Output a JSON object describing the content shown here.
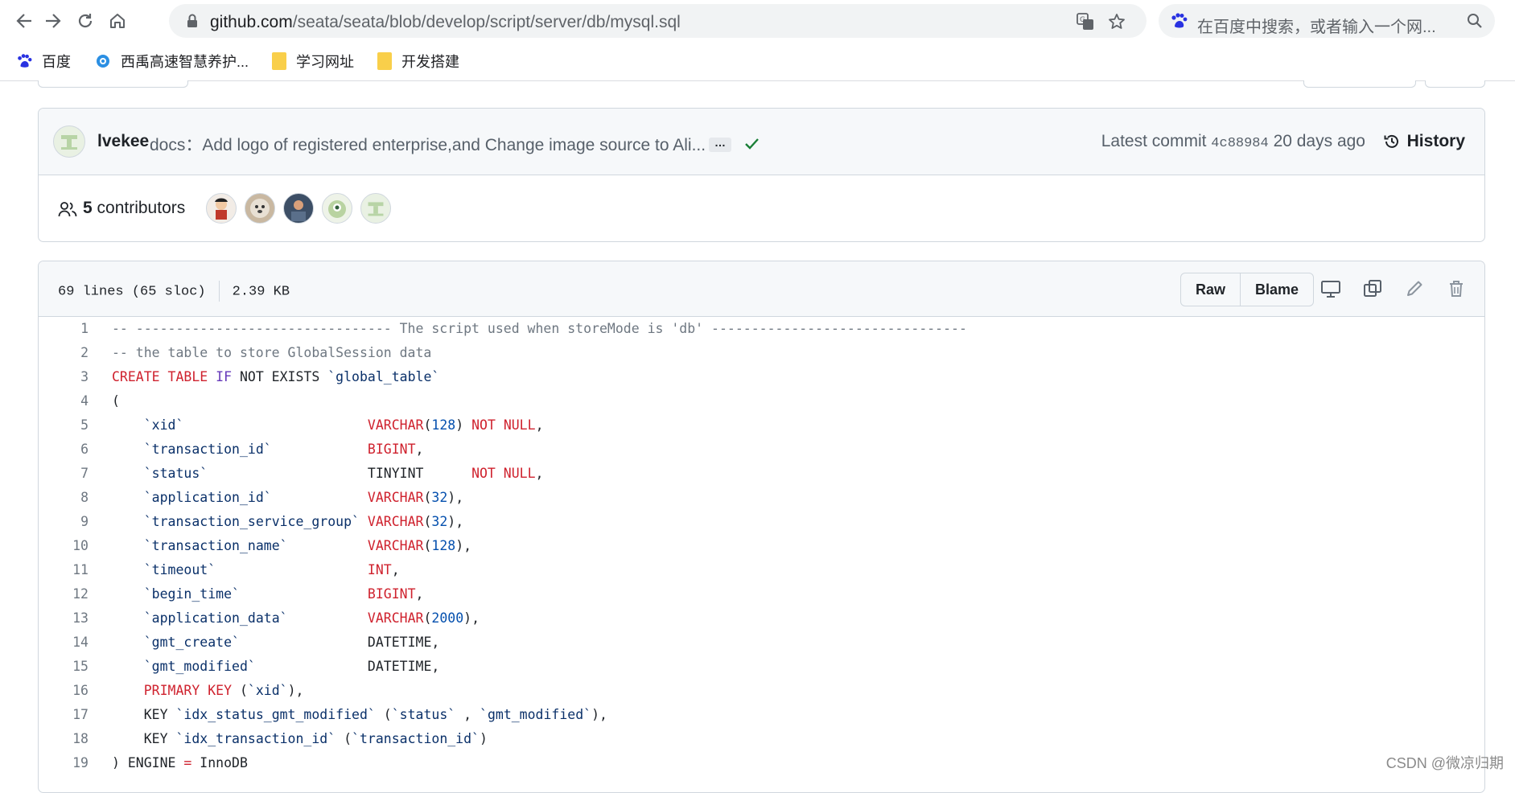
{
  "browser": {
    "url_host": "github.com",
    "url_path": "/seata/seata/blob/develop/script/server/db/mysql.sql",
    "search_placeholder": "在百度中搜索，或者输入一个网...",
    "bookmarks": [
      {
        "label": "百度",
        "icon": "baidu-paw-icon"
      },
      {
        "label": "西禹高速智慧养护...",
        "icon": "site-globe-icon"
      },
      {
        "label": "学习网址",
        "icon": "folder-icon"
      },
      {
        "label": "开发搭建",
        "icon": "folder-icon"
      }
    ]
  },
  "commit": {
    "author": "lvekee",
    "message": "docs：Add logo of registered enterprise,and Change image source to Ali...",
    "ellipsis": "…",
    "latest_label": "Latest commit",
    "sha": "4c88984",
    "age": "20 days ago",
    "history_label": "History",
    "contributors_count": "5",
    "contributors_label": "contributors"
  },
  "file": {
    "lines_info": "69 lines (65 sloc)",
    "size": "2.39 KB",
    "raw_label": "Raw",
    "blame_label": "Blame"
  },
  "code_lines": [
    {
      "n": "1",
      "segs": [
        [
          "c",
          "-- -------------------------------- The script used when storeMode is 'db' --------------------------------"
        ]
      ]
    },
    {
      "n": "2",
      "segs": [
        [
          "c",
          "-- the table to store GlobalSession data"
        ]
      ]
    },
    {
      "n": "3",
      "segs": [
        [
          "k",
          "CREATE TABLE "
        ],
        [
          "k2",
          "IF"
        ],
        [
          "p",
          " NOT EXISTS "
        ],
        [
          "s",
          "`global_table`"
        ]
      ]
    },
    {
      "n": "4",
      "segs": [
        [
          "p",
          "("
        ]
      ]
    },
    {
      "n": "5",
      "segs": [
        [
          "p",
          "    "
        ],
        [
          "s",
          "`xid`"
        ],
        [
          "p",
          "                       "
        ],
        [
          "k",
          "VARCHAR"
        ],
        [
          "p",
          "("
        ],
        [
          "n",
          "128"
        ],
        [
          "p",
          ") "
        ],
        [
          "k",
          "NOT NULL"
        ],
        [
          "p",
          ","
        ]
      ]
    },
    {
      "n": "6",
      "segs": [
        [
          "p",
          "    "
        ],
        [
          "s",
          "`transaction_id`"
        ],
        [
          "p",
          "            "
        ],
        [
          "k",
          "BIGINT"
        ],
        [
          "p",
          ","
        ]
      ]
    },
    {
      "n": "7",
      "segs": [
        [
          "p",
          "    "
        ],
        [
          "s",
          "`status`"
        ],
        [
          "p",
          "                    TINYINT      "
        ],
        [
          "k",
          "NOT NULL"
        ],
        [
          "p",
          ","
        ]
      ]
    },
    {
      "n": "8",
      "segs": [
        [
          "p",
          "    "
        ],
        [
          "s",
          "`application_id`"
        ],
        [
          "p",
          "            "
        ],
        [
          "k",
          "VARCHAR"
        ],
        [
          "p",
          "("
        ],
        [
          "n",
          "32"
        ],
        [
          "p",
          "),"
        ]
      ]
    },
    {
      "n": "9",
      "segs": [
        [
          "p",
          "    "
        ],
        [
          "s",
          "`transaction_service_group`"
        ],
        [
          "p",
          " "
        ],
        [
          "k",
          "VARCHAR"
        ],
        [
          "p",
          "("
        ],
        [
          "n",
          "32"
        ],
        [
          "p",
          "),"
        ]
      ]
    },
    {
      "n": "10",
      "segs": [
        [
          "p",
          "    "
        ],
        [
          "s",
          "`transaction_name`"
        ],
        [
          "p",
          "          "
        ],
        [
          "k",
          "VARCHAR"
        ],
        [
          "p",
          "("
        ],
        [
          "n",
          "128"
        ],
        [
          "p",
          "),"
        ]
      ]
    },
    {
      "n": "11",
      "segs": [
        [
          "p",
          "    "
        ],
        [
          "s",
          "`timeout`"
        ],
        [
          "p",
          "                   "
        ],
        [
          "k",
          "INT"
        ],
        [
          "p",
          ","
        ]
      ]
    },
    {
      "n": "12",
      "segs": [
        [
          "p",
          "    "
        ],
        [
          "s",
          "`begin_time`"
        ],
        [
          "p",
          "                "
        ],
        [
          "k",
          "BIGINT"
        ],
        [
          "p",
          ","
        ]
      ]
    },
    {
      "n": "13",
      "segs": [
        [
          "p",
          "    "
        ],
        [
          "s",
          "`application_data`"
        ],
        [
          "p",
          "          "
        ],
        [
          "k",
          "VARCHAR"
        ],
        [
          "p",
          "("
        ],
        [
          "n",
          "2000"
        ],
        [
          "p",
          "),"
        ]
      ]
    },
    {
      "n": "14",
      "segs": [
        [
          "p",
          "    "
        ],
        [
          "s",
          "`gmt_create`"
        ],
        [
          "p",
          "                DATETIME,"
        ]
      ]
    },
    {
      "n": "15",
      "segs": [
        [
          "p",
          "    "
        ],
        [
          "s",
          "`gmt_modified`"
        ],
        [
          "p",
          "              DATETIME,"
        ]
      ]
    },
    {
      "n": "16",
      "segs": [
        [
          "p",
          "    "
        ],
        [
          "k",
          "PRIMARY KEY"
        ],
        [
          "p",
          " ("
        ],
        [
          "s",
          "`xid`"
        ],
        [
          "p",
          "),"
        ]
      ]
    },
    {
      "n": "17",
      "segs": [
        [
          "p",
          "    KEY "
        ],
        [
          "s",
          "`idx_status_gmt_modified`"
        ],
        [
          "p",
          " ("
        ],
        [
          "s",
          "`status`"
        ],
        [
          "p",
          " , "
        ],
        [
          "s",
          "`gmt_modified`"
        ],
        [
          "p",
          "),"
        ]
      ]
    },
    {
      "n": "18",
      "segs": [
        [
          "p",
          "    KEY "
        ],
        [
          "s",
          "`idx_transaction_id`"
        ],
        [
          "p",
          " ("
        ],
        [
          "s",
          "`transaction_id`"
        ],
        [
          "p",
          ")"
        ]
      ]
    },
    {
      "n": "19",
      "segs": [
        [
          "p",
          ") ENGINE "
        ],
        [
          "k",
          "="
        ],
        [
          "p",
          " InnoDB"
        ]
      ]
    }
  ],
  "watermark": "CSDN @微凉归期",
  "colors": {
    "keyword": "#cf222e",
    "keyword_alt": "#6639ba",
    "string": "#0a3069",
    "number": "#0550ae",
    "comment": "#6e7781",
    "check": "#1a7f37"
  }
}
